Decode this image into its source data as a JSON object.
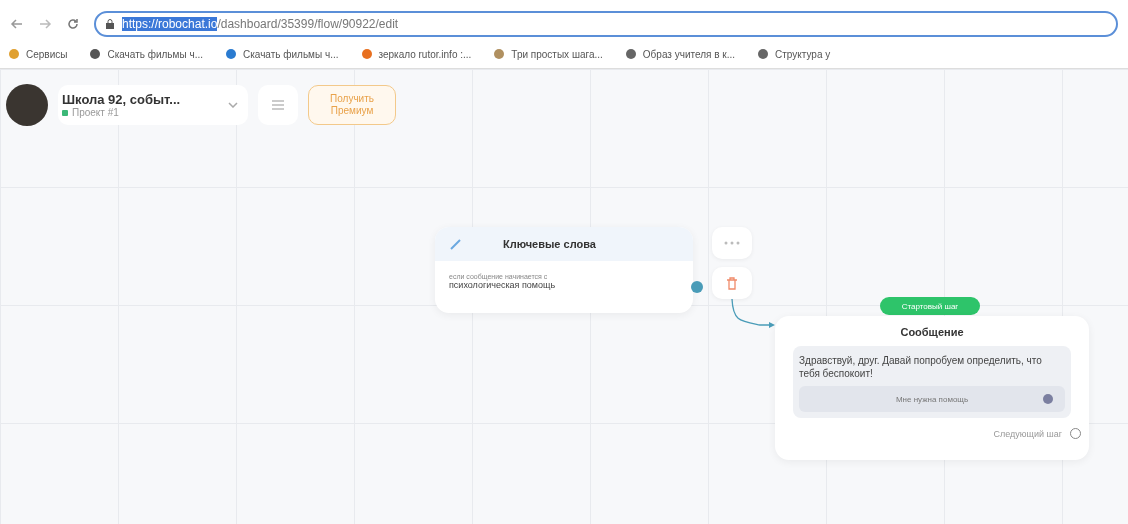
{
  "browser": {
    "url_selected": "https://robochat.io",
    "url_rest": "/dashboard/35399/flow/90922/edit",
    "bookmarks": [
      {
        "label": "Сервисы",
        "kind": "apps"
      },
      {
        "label": "Скачать фильмы ч...",
        "kind": "disc"
      },
      {
        "label": "Скачать фильмы ч...",
        "kind": "cone"
      },
      {
        "label": "зеркало rutor.info :...",
        "kind": "flower"
      },
      {
        "label": "Три простых шага...",
        "kind": "picture"
      },
      {
        "label": "Образ учителя в к...",
        "kind": "globe"
      },
      {
        "label": "Структура у",
        "kind": "globe"
      }
    ]
  },
  "project": {
    "title": "Школа 92, событ...",
    "subtitle": "Проект #1",
    "premium_button": "Получить Премиум"
  },
  "nodes": [
    {
      "kind": "keywords",
      "title": "Ключевые слова",
      "caption": "если сообщение начинается с",
      "keyword": "психологическая помощь"
    },
    {
      "kind": "message",
      "badge": "Стартовый шаг",
      "title": "Сообщение",
      "text": "Здравствуй, друг. Давай попробуем определить, что тебя беспокоит!",
      "button": "Мне нужна помощь",
      "next": "Следующий шаг"
    }
  ]
}
